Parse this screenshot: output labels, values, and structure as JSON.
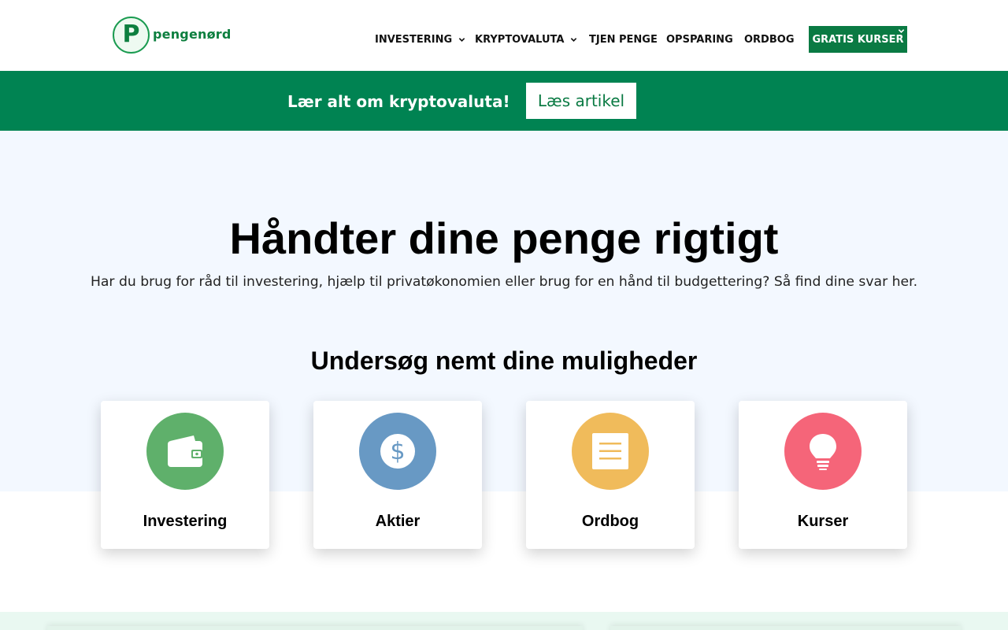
{
  "header": {
    "logo_letter": "P",
    "logo_text": "pengenørd",
    "nav": [
      {
        "label": "INVESTERING",
        "has_dropdown": true
      },
      {
        "label": "KRYPTOVALUTA",
        "has_dropdown": true
      },
      {
        "label": "TJEN PENGE",
        "has_dropdown": false
      },
      {
        "label": "OPSPARING",
        "has_dropdown": false
      },
      {
        "label": "ORDBOG",
        "has_dropdown": false
      }
    ],
    "cta_label": "GRATIS KURSER"
  },
  "banner": {
    "text": "Lær alt om kryptovaluta!",
    "button_label": "Læs artikel"
  },
  "hero": {
    "title": "Håndter dine penge rigtigt",
    "subtitle": "Har du brug for råd til investering, hjælp til privatøkonomien eller brug for en hånd til budgettering? Så find dine svar her.",
    "section_title": "Undersøg nemt dine muligheder"
  },
  "cards": [
    {
      "label": "Investering",
      "icon": "wallet-icon",
      "color": "#5fb06b"
    },
    {
      "label": "Aktier",
      "icon": "dollar-icon",
      "color": "#6899c4"
    },
    {
      "label": "Ordbog",
      "icon": "document-icon",
      "color": "#f0bb5b"
    },
    {
      "label": "Kurser",
      "icon": "lightbulb-icon",
      "color": "#f56579"
    }
  ],
  "colors": {
    "brand_green": "#008352",
    "hero_bg": "#f3f8ff"
  }
}
